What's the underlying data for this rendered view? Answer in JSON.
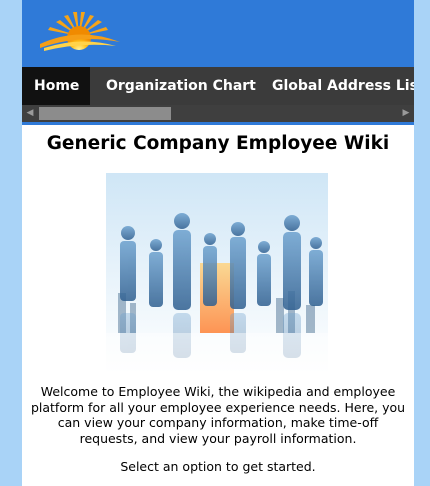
{
  "nav": {
    "items": [
      {
        "label": "Home",
        "active": true
      },
      {
        "label": "Organization Chart",
        "active": false
      },
      {
        "label": "Global Address List",
        "active": false
      }
    ]
  },
  "main": {
    "title": "Generic Company Employee Wiki",
    "intro": "Welcome to Employee Wiki, the wikipedia and employee platform for all your employee experience needs. Here, you can view your company information, make time-off requests, and view your payroll information.",
    "call_to_action": "Select an option to get started."
  },
  "colors": {
    "header": "#2f7ad8",
    "nav_background": "#3b3b3b",
    "nav_active": "#111111",
    "page_background": "#a9d3f7"
  },
  "icons": {
    "logo": "sunrise-logo",
    "hero": "business-people-silhouettes"
  }
}
